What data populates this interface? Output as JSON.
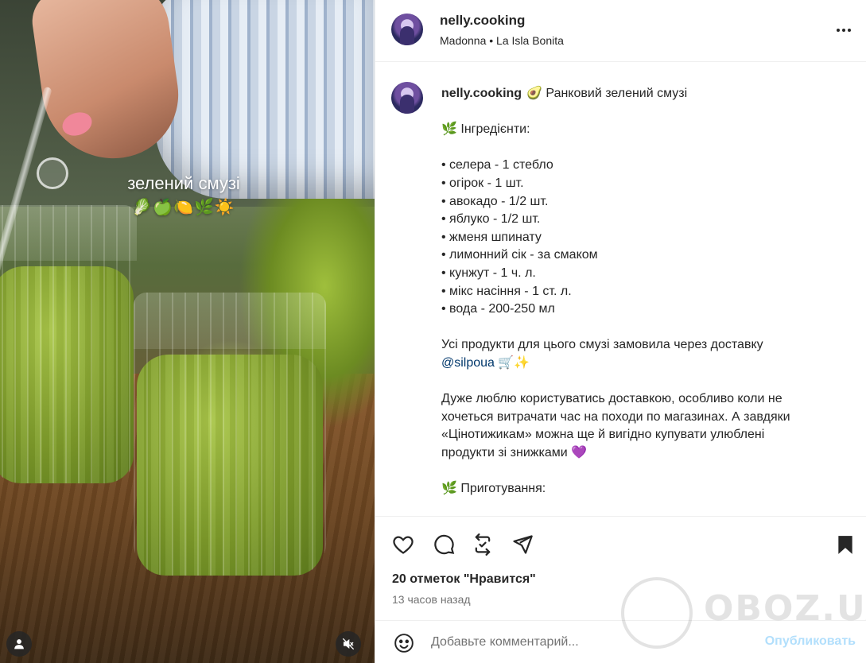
{
  "post": {
    "author": "nelly.cooking",
    "music": "Madonna • La Isla Bonita"
  },
  "media": {
    "overlay_title": "зелений смузі",
    "overlay_emoji": "🥬🍏🍋🌿☀️"
  },
  "caption": {
    "author": "nelly.cooking",
    "lines": [
      "🥑  Ранковий зелений смузі",
      "",
      "🌿  Інгредієнти:",
      "",
      "• селера - 1 стебло",
      "• огірок - 1 шт.",
      "• авокадо - 1/2 шт.",
      "• яблуко - 1/2 шт.",
      "• жменя шпинату",
      "• лимонний сік - за смаком",
      "• кунжут - 1 ч. л.",
      "• мікс насіння - 1 ст. л.",
      "• вода - 200-250 мл",
      "",
      "Усі продукти для цього смузі замовила через доставку",
      "",
      "",
      "Дуже люблю користуватись доставкою, особливо коли не",
      "хочеться витрачати час на походи по магазинах. А завдяки",
      "«Цінотижикам» можна ще й вигідно купувати улюблені",
      "продукти зі знижками 💜",
      "",
      "🌿  Приготування:"
    ],
    "mention": "@silpoua",
    "mention_suffix": " 🛒✨"
  },
  "engagement": {
    "likes": "20 отметок \"Нравится\"",
    "time": "13 часов назад"
  },
  "comment": {
    "placeholder": "Добавьте комментарий...",
    "publish": "Опубликовать"
  },
  "watermark": {
    "text": "OBOZ.UA"
  },
  "colors": {
    "accent_link": "#00376b",
    "publish_disabled": "#b2dffc",
    "secondary_text": "#737373",
    "divider": "#efefef"
  }
}
